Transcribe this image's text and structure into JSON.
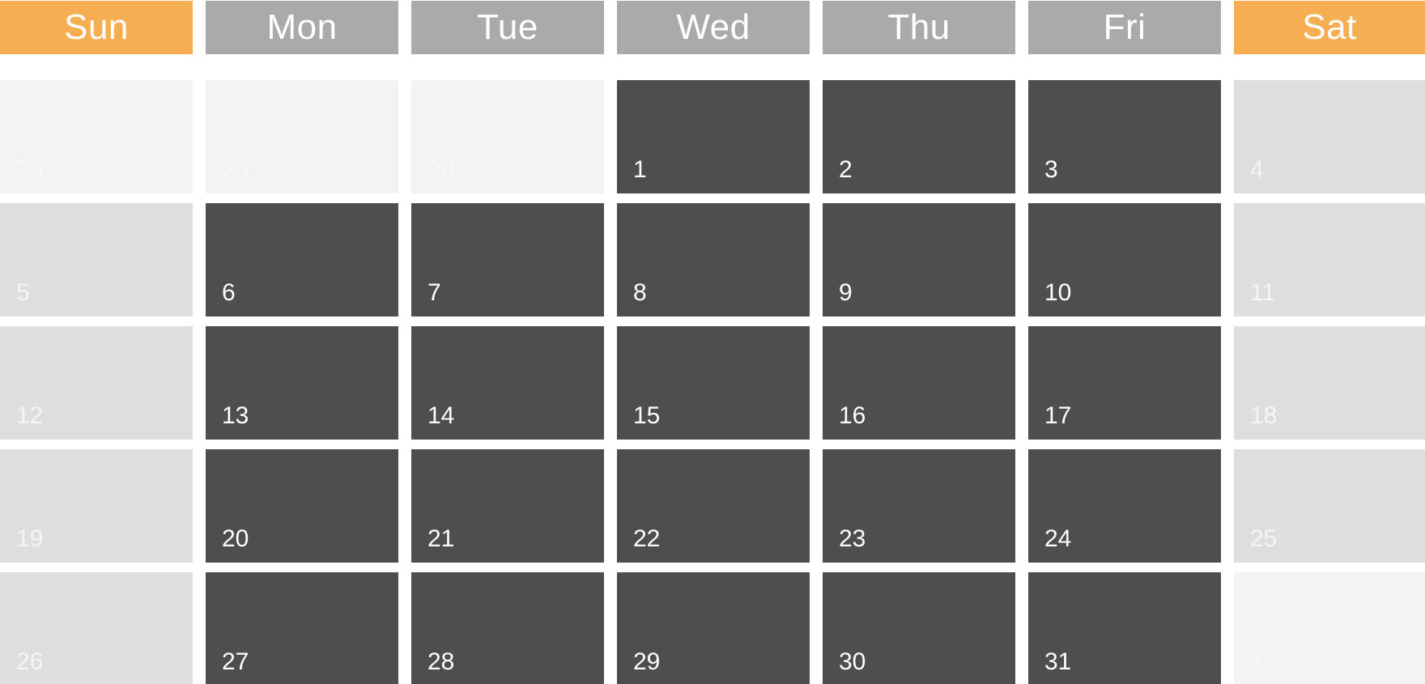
{
  "headers": [
    {
      "label": "Sun",
      "type": "weekend"
    },
    {
      "label": "Mon",
      "type": "weekday"
    },
    {
      "label": "Tue",
      "type": "weekday"
    },
    {
      "label": "Wed",
      "type": "weekday"
    },
    {
      "label": "Thu",
      "type": "weekday"
    },
    {
      "label": "Fri",
      "type": "weekday"
    },
    {
      "label": "Sat",
      "type": "weekend"
    }
  ],
  "weeks": [
    [
      {
        "day": "28",
        "type": "outside"
      },
      {
        "day": "29",
        "type": "outside"
      },
      {
        "day": "30",
        "type": "outside"
      },
      {
        "day": "1",
        "type": "weekday"
      },
      {
        "day": "2",
        "type": "weekday"
      },
      {
        "day": "3",
        "type": "weekday"
      },
      {
        "day": "4",
        "type": "weekend"
      }
    ],
    [
      {
        "day": "5",
        "type": "weekend"
      },
      {
        "day": "6",
        "type": "weekday"
      },
      {
        "day": "7",
        "type": "weekday"
      },
      {
        "day": "8",
        "type": "weekday"
      },
      {
        "day": "9",
        "type": "weekday"
      },
      {
        "day": "10",
        "type": "weekday"
      },
      {
        "day": "11",
        "type": "weekend"
      }
    ],
    [
      {
        "day": "12",
        "type": "weekend"
      },
      {
        "day": "13",
        "type": "weekday"
      },
      {
        "day": "14",
        "type": "weekday"
      },
      {
        "day": "15",
        "type": "weekday"
      },
      {
        "day": "16",
        "type": "weekday"
      },
      {
        "day": "17",
        "type": "weekday"
      },
      {
        "day": "18",
        "type": "weekend"
      }
    ],
    [
      {
        "day": "19",
        "type": "weekend"
      },
      {
        "day": "20",
        "type": "weekday"
      },
      {
        "day": "21",
        "type": "weekday"
      },
      {
        "day": "22",
        "type": "weekday"
      },
      {
        "day": "23",
        "type": "weekday"
      },
      {
        "day": "24",
        "type": "weekday"
      },
      {
        "day": "25",
        "type": "weekend"
      }
    ],
    [
      {
        "day": "26",
        "type": "weekend"
      },
      {
        "day": "27",
        "type": "weekday"
      },
      {
        "day": "28",
        "type": "weekday"
      },
      {
        "day": "29",
        "type": "weekday"
      },
      {
        "day": "30",
        "type": "weekday"
      },
      {
        "day": "31",
        "type": "weekday"
      },
      {
        "day": "1",
        "type": "outside"
      }
    ]
  ],
  "colors": {
    "weekend_header": "#f5ae52",
    "weekday_header": "#aaaaaa",
    "weekday_cell": "#4e4e4e",
    "weekend_cell": "#dedede",
    "outside_cell": "#f3f3f3"
  }
}
